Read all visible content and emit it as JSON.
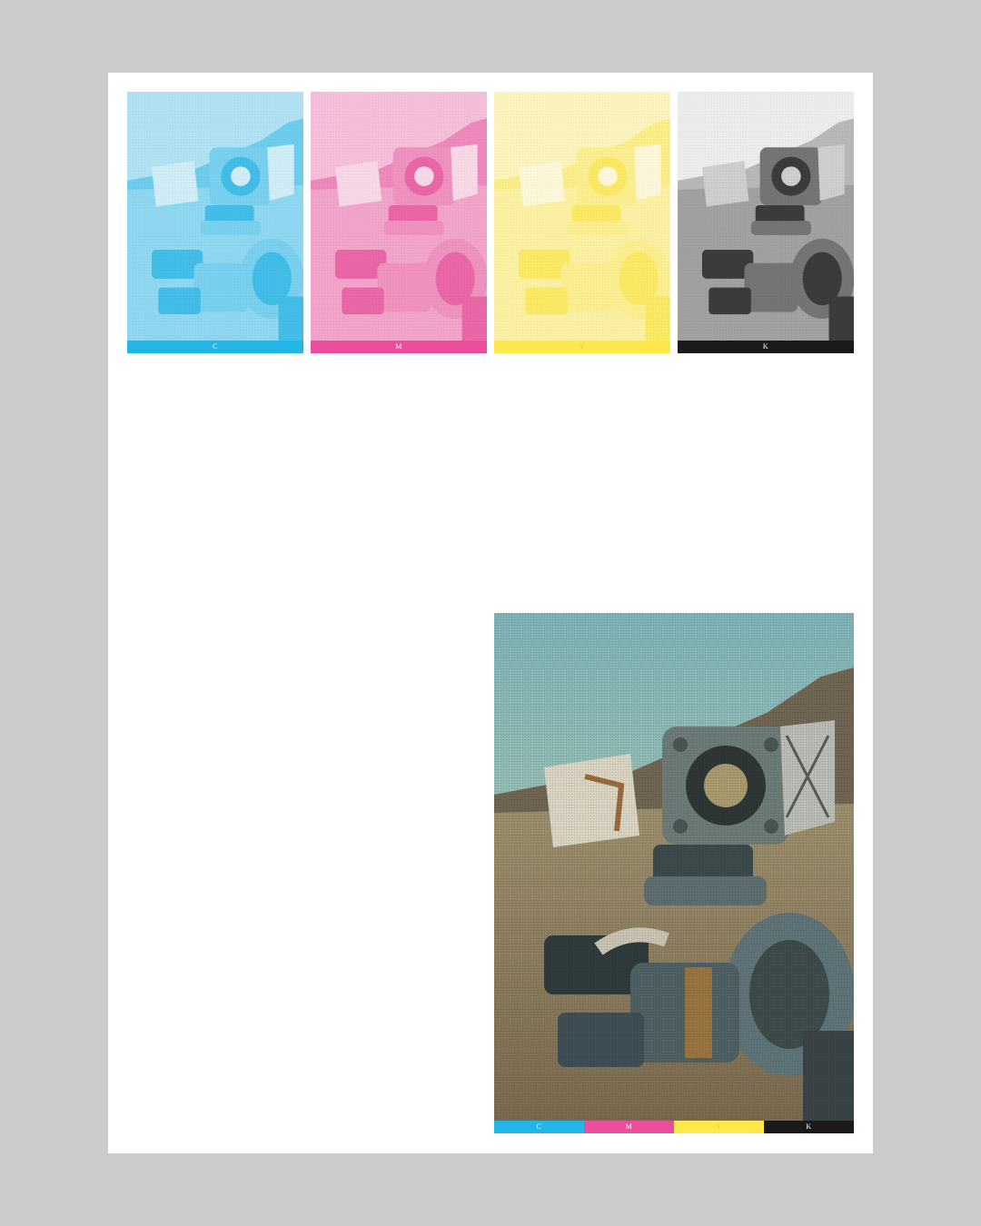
{
  "colors": {
    "cyan": "#22b5e8",
    "magenta": "#ea4d9a",
    "yellow": "#ffe94a",
    "black": "#1a1a1a",
    "background": "#cbcbcb",
    "sheet": "#ffffff"
  },
  "separations": [
    {
      "label": "C",
      "ink": "cyan"
    },
    {
      "label": "M",
      "ink": "magenta"
    },
    {
      "label": "Y",
      "ink": "yellow"
    },
    {
      "label": "K",
      "ink": "black"
    }
  ],
  "composite": {
    "labels": [
      "C",
      "M",
      "Y",
      "K"
    ]
  }
}
